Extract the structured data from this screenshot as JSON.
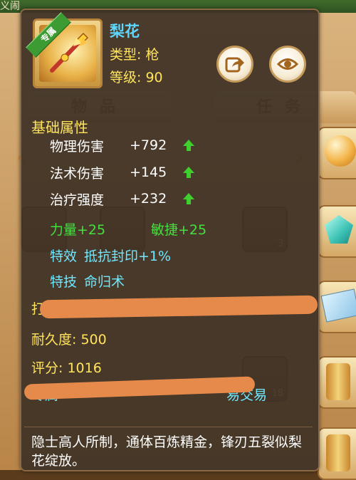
{
  "background": {
    "top_text": "义闹",
    "tab_left": "物品",
    "tab_right": "任务",
    "cell_counts": [
      "3",
      "18"
    ]
  },
  "item": {
    "exclusive_badge": "专属",
    "name": "梨花",
    "type_line": "类型: 枪",
    "level_line": "等级: 90"
  },
  "section_basic": "基础属性",
  "stats": [
    {
      "label": "物理伤害",
      "value": "+792",
      "arrow": "up-green"
    },
    {
      "label": "法术伤害",
      "value": "+145",
      "arrow": "up-green"
    },
    {
      "label": "治疗强度",
      "value": "+232",
      "arrow": "up-green"
    }
  ],
  "attributes": {
    "strength": "力量+25",
    "agility": "敏捷+25"
  },
  "special_effect": {
    "key": "特效",
    "value": "抵抗封印+1%"
  },
  "special_skill": {
    "key": "特技",
    "value": "命归术"
  },
  "forge_partial": "打造",
  "durability": "耐久度: 500",
  "score": "评分: 1016",
  "exclusive_line_start": "专属",
  "exclusive_line_end": "易交易",
  "description": "隐士高人所制，通体百炼精金，锋刃五裂似梨花绽放。",
  "colors": {
    "name": "#5dd7ff",
    "yellow_text": "#ffe45c",
    "green_attr": "#45e040",
    "cyan_text": "#6ee7ff",
    "scribble": "#e58a4b"
  }
}
